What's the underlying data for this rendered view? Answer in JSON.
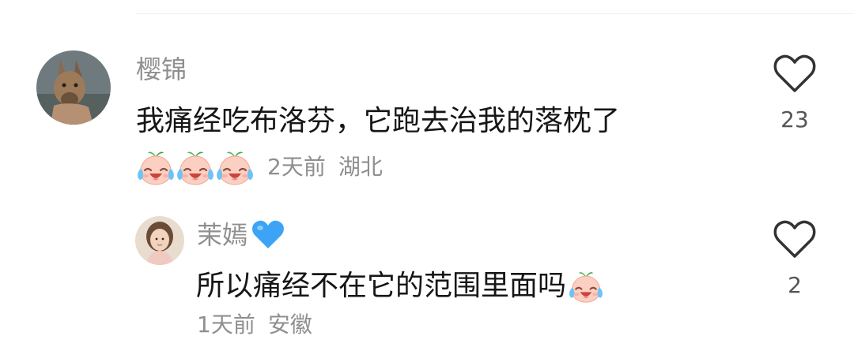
{
  "comments": [
    {
      "username": "樱锦",
      "text": "我痛经吃布洛芬，它跑去治我的落枕了",
      "reaction_emojis": [
        "crying-laughing-peach",
        "crying-laughing-peach",
        "crying-laughing-peach"
      ],
      "time": "2天前",
      "location": "湖北",
      "like_count": "23"
    },
    {
      "username": "茉嫣",
      "name_emoji": "blue-heart",
      "text": "所以痛经不在它的范围里面吗",
      "text_emoji": "crying-laughing-peach",
      "time": "1天前",
      "location": "安徽",
      "like_count": "2"
    }
  ],
  "colors": {
    "secondary_text": "#8f8f8f",
    "primary_text": "#161616",
    "heart_outline": "#333333",
    "blue_heart": "#3da3f5"
  },
  "icons": [
    "heart-outline-icon",
    "crying-laughing-peach-emoji",
    "blue-heart-emoji"
  ]
}
